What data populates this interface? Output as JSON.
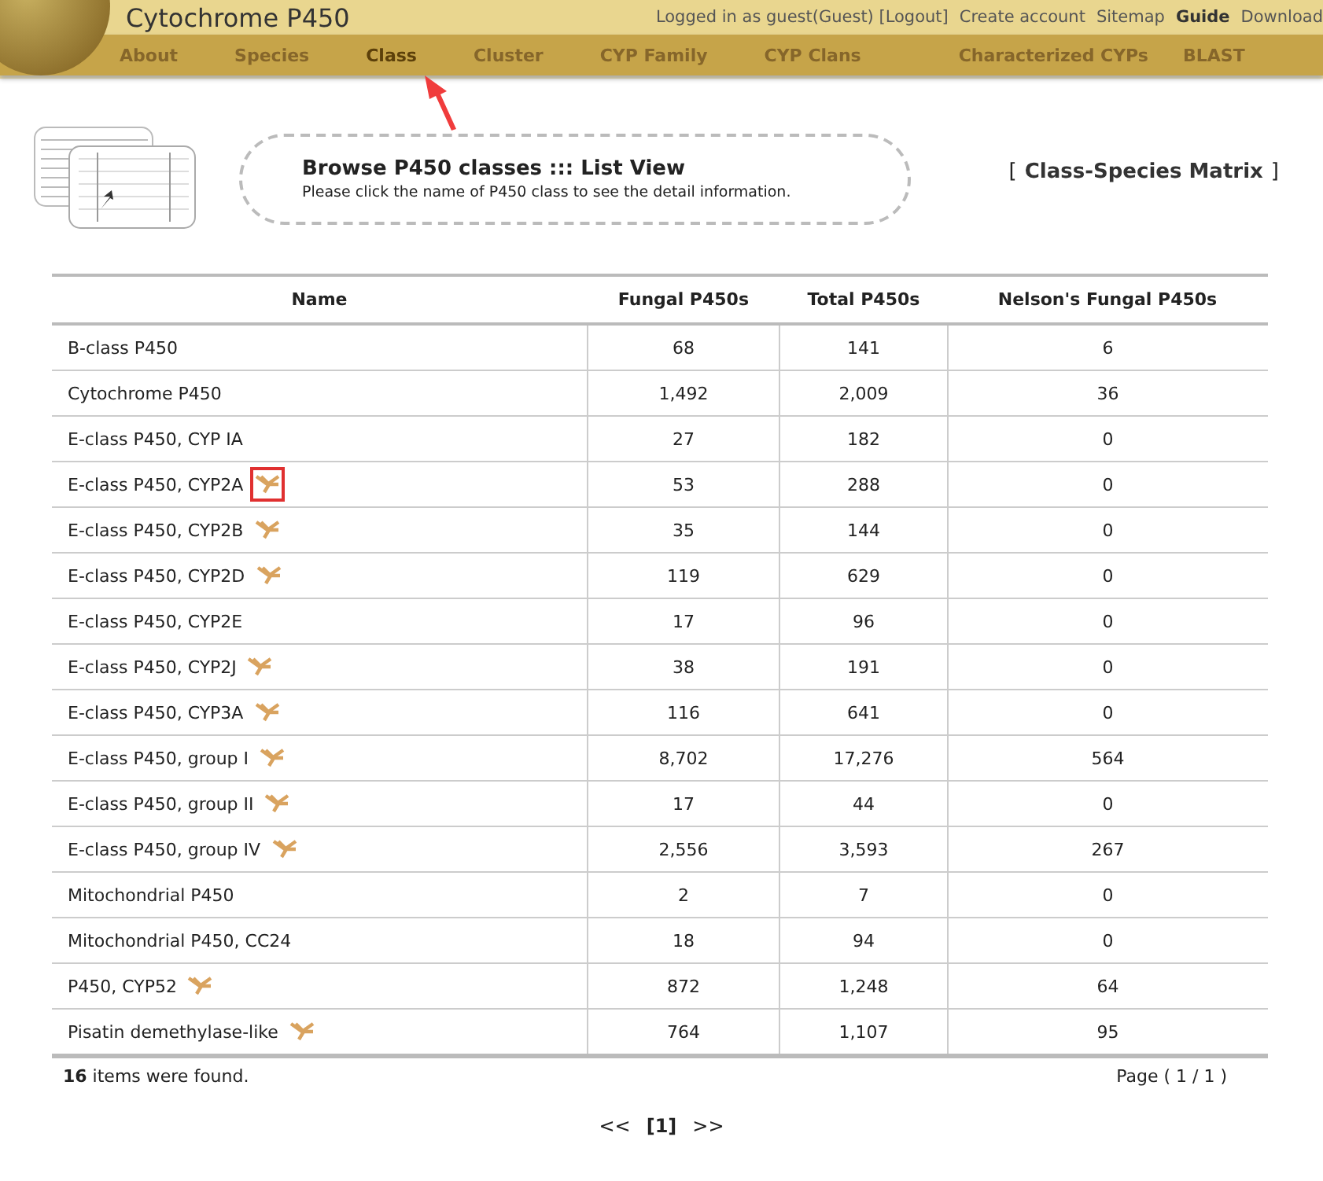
{
  "site_title": "Cytochrome P450",
  "user_links": [
    {
      "label": "Logged in as guest(Guest) [Logout]",
      "bold": false
    },
    {
      "label": "Create account",
      "bold": false
    },
    {
      "label": "Sitemap",
      "bold": false
    },
    {
      "label": "Guide",
      "bold": true
    },
    {
      "label": "Download",
      "bold": false
    }
  ],
  "nav": [
    {
      "label": "About",
      "selected": false
    },
    {
      "label": "Species",
      "selected": false
    },
    {
      "label": "Class",
      "selected": true
    },
    {
      "label": "Cluster",
      "selected": false
    },
    {
      "label": "CYP Family",
      "selected": false
    },
    {
      "label": "CYP Clans",
      "selected": false
    },
    {
      "label": "Characterized CYPs",
      "selected": false
    },
    {
      "label": "BLAST",
      "selected": false
    }
  ],
  "banner": {
    "title": "Browse P450 classes ::: List View",
    "subtitle": "Please click the name of P450 class to see the detail information.",
    "link_open": "[",
    "link": "Class-Species Matrix",
    "link_close": "]"
  },
  "table": {
    "columns": [
      "Name",
      "Fungal P450s",
      "Total P450s",
      "Nelson's Fungal P450s"
    ],
    "rows": [
      {
        "icon": false,
        "highlighted": false,
        "cells": [
          "B-class P450",
          "68",
          "141",
          "6"
        ]
      },
      {
        "icon": false,
        "highlighted": false,
        "cells": [
          "Cytochrome P450",
          "1,492",
          "2,009",
          "36"
        ]
      },
      {
        "icon": false,
        "highlighted": false,
        "cells": [
          "E-class P450, CYP IA",
          "27",
          "182",
          "0"
        ]
      },
      {
        "icon": true,
        "highlighted": true,
        "cells": [
          "E-class P450, CYP2A",
          "53",
          "288",
          "0"
        ]
      },
      {
        "icon": true,
        "highlighted": false,
        "cells": [
          "E-class P450, CYP2B",
          "35",
          "144",
          "0"
        ]
      },
      {
        "icon": true,
        "highlighted": false,
        "cells": [
          "E-class P450, CYP2D",
          "119",
          "629",
          "0"
        ]
      },
      {
        "icon": false,
        "highlighted": false,
        "cells": [
          "E-class P450, CYP2E",
          "17",
          "96",
          "0"
        ]
      },
      {
        "icon": true,
        "highlighted": false,
        "cells": [
          "E-class P450, CYP2J",
          "38",
          "191",
          "0"
        ]
      },
      {
        "icon": true,
        "highlighted": false,
        "cells": [
          "E-class P450, CYP3A",
          "116",
          "641",
          "0"
        ]
      },
      {
        "icon": true,
        "highlighted": false,
        "cells": [
          "E-class P450, group I",
          "8,702",
          "17,276",
          "564"
        ]
      },
      {
        "icon": true,
        "highlighted": false,
        "cells": [
          "E-class P450, group II",
          "17",
          "44",
          "0"
        ]
      },
      {
        "icon": true,
        "highlighted": false,
        "cells": [
          "E-class P450, group IV",
          "2,556",
          "3,593",
          "267"
        ]
      },
      {
        "icon": false,
        "highlighted": false,
        "cells": [
          "Mitochondrial P450",
          "2",
          "7",
          "0"
        ]
      },
      {
        "icon": false,
        "highlighted": false,
        "cells": [
          "Mitochondrial P450, CC24",
          "18",
          "94",
          "0"
        ]
      },
      {
        "icon": true,
        "highlighted": false,
        "cells": [
          "P450, CYP52",
          "872",
          "1,248",
          "64"
        ]
      },
      {
        "icon": true,
        "highlighted": false,
        "cells": [
          "Pisatin demethylase-like",
          "764",
          "1,107",
          "95"
        ]
      }
    ]
  },
  "footer": {
    "count": "16",
    "count_text": "items were found.",
    "page": "Page ( 1 / 1 )"
  },
  "pager": {
    "prev": "<<",
    "current": "[1]",
    "next": ">>"
  }
}
